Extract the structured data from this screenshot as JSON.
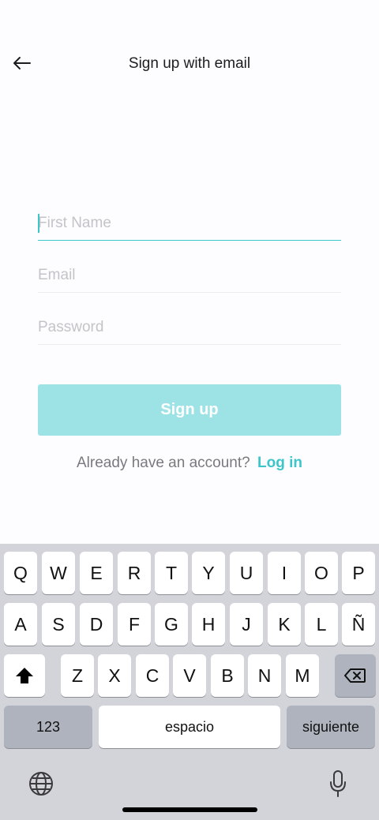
{
  "header": {
    "title": "Sign up with email"
  },
  "form": {
    "first_name_placeholder": "First Name",
    "email_placeholder": "Email",
    "password_placeholder": "Password",
    "signup_label": "Sign up",
    "login_prompt": "Already have an account?",
    "login_link": "Log in"
  },
  "keyboard": {
    "row1": [
      "Q",
      "W",
      "E",
      "R",
      "T",
      "Y",
      "U",
      "I",
      "O",
      "P"
    ],
    "row2": [
      "A",
      "S",
      "D",
      "F",
      "G",
      "H",
      "J",
      "K",
      "L",
      "Ñ"
    ],
    "row3": [
      "Z",
      "X",
      "C",
      "V",
      "B",
      "N",
      "M"
    ],
    "numbers_label": "123",
    "space_label": "espacio",
    "next_label": "siguiente",
    "icons": [
      "shift-icon",
      "delete-icon",
      "globe-icon",
      "microphone-icon"
    ]
  },
  "colors": {
    "accent": "#3cc6c9",
    "button_disabled": "#9de3e6",
    "keyboard_bg": "#d2d4da"
  }
}
